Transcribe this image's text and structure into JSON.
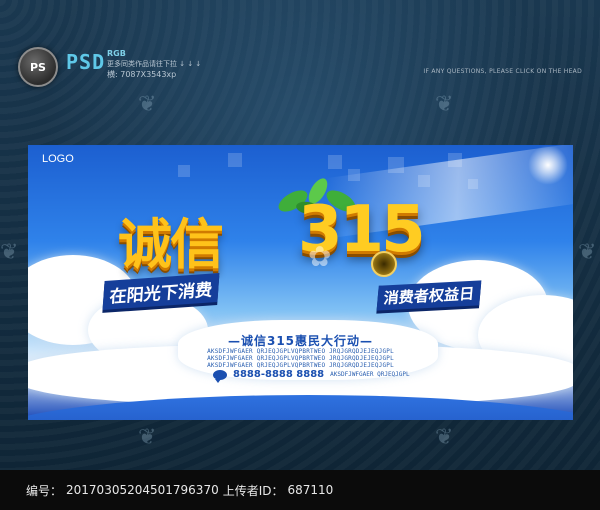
{
  "header": {
    "ps_badge": "PS",
    "psd_logo": "PSD",
    "rgb_tag": "RGB",
    "info_line1": "更多同类作品请往下拉 ↓ ↓ ↓",
    "info_line2": "横: 7087X3543xp",
    "tip_right": "IF ANY QUESTIONS, PLEASE CLICK ON THE HEAD"
  },
  "poster": {
    "logo": "LOGO",
    "title_chars": "诚信",
    "title_number": "315",
    "slogan_left": "在阳光下消费",
    "slogan_right": "消费者权益日",
    "action_title": "—诚信315惠民大行动—",
    "filler_line1": "AKSDFJWFGAER QRJEQJGPLVQPBRTWEO JRQJGRQDJEJEQJGPL",
    "filler_line2": "AKSDFJWFGAER QRJEQJGPLVQPBRTWEO JRQJGRQDJEJEQJGPL",
    "filler_line3": "AKSDFJWFGAER QRJEQJGPLVQPBRTWEO JRQJGRQDJEJEQJGPL",
    "phone": "8888-8888 8888",
    "phone_filler": "AKSDFJWFGAER QRJEQJGPL"
  },
  "footer": {
    "id_label": "编号：",
    "id_value": "20170305204501796370",
    "uploader_label": "上传者ID：",
    "uploader_value": "687110"
  },
  "colors": {
    "background": "#12283a",
    "accent_cyan": "#5fc8e8",
    "title_gold": "#ffc21a",
    "poster_blue": "#1c5fd0",
    "footer_bg": "#0b0b0b"
  }
}
